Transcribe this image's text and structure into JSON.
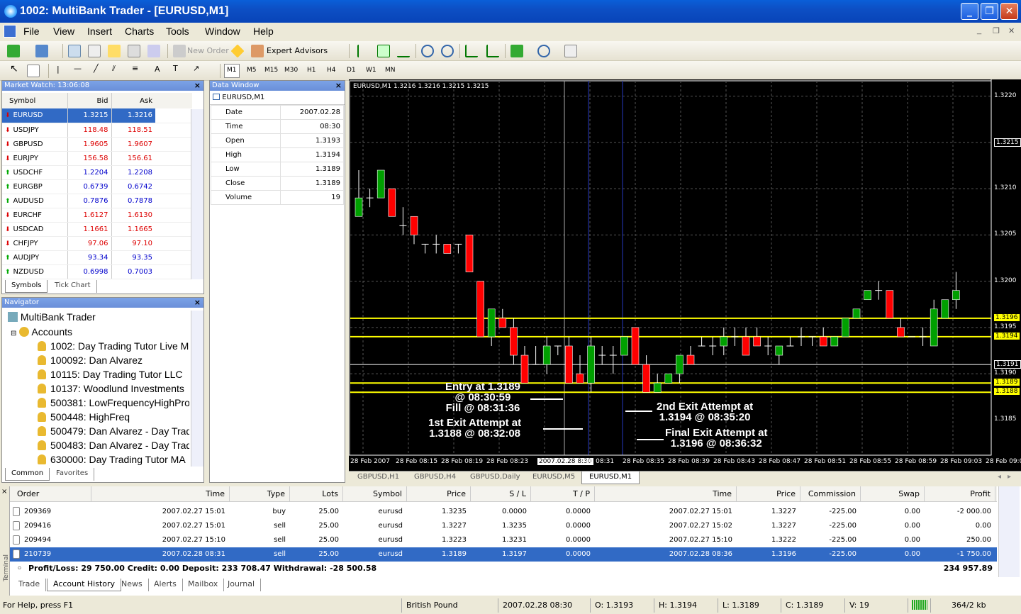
{
  "window": {
    "title": "1002: MultiBank Trader - [EURUSD,M1]"
  },
  "menu": [
    "File",
    "View",
    "Insert",
    "Charts",
    "Tools",
    "Window",
    "Help"
  ],
  "toolbar": {
    "new_order": "New Order",
    "expert_advisors": "Expert Advisors",
    "timeframes": [
      "M1",
      "M5",
      "M15",
      "M30",
      "H1",
      "H4",
      "D1",
      "W1",
      "MN"
    ]
  },
  "market_watch": {
    "title": "Market Watch: 13:06:08",
    "cols": [
      "Symbol",
      "Bid",
      "Ask"
    ],
    "rows": [
      {
        "sym": "EURUSD",
        "bid": "1.3215",
        "ask": "1.3216",
        "dir": "down",
        "sel": true
      },
      {
        "sym": "USDJPY",
        "bid": "118.48",
        "ask": "118.51",
        "dir": "down"
      },
      {
        "sym": "GBPUSD",
        "bid": "1.9605",
        "ask": "1.9607",
        "dir": "down"
      },
      {
        "sym": "EURJPY",
        "bid": "156.58",
        "ask": "156.61",
        "dir": "down"
      },
      {
        "sym": "USDCHF",
        "bid": "1.2204",
        "ask": "1.2208",
        "dir": "up"
      },
      {
        "sym": "EURGBP",
        "bid": "0.6739",
        "ask": "0.6742",
        "dir": "up"
      },
      {
        "sym": "AUDUSD",
        "bid": "0.7876",
        "ask": "0.7878",
        "dir": "up"
      },
      {
        "sym": "EURCHF",
        "bid": "1.6127",
        "ask": "1.6130",
        "dir": "down"
      },
      {
        "sym": "USDCAD",
        "bid": "1.1661",
        "ask": "1.1665",
        "dir": "down"
      },
      {
        "sym": "CHFJPY",
        "bid": "97.06",
        "ask": "97.10",
        "dir": "down"
      },
      {
        "sym": "AUDJPY",
        "bid": "93.34",
        "ask": "93.35",
        "dir": "up"
      },
      {
        "sym": "NZDUSD",
        "bid": "0.6998",
        "ask": "0.7003",
        "dir": "up"
      }
    ],
    "tabs": [
      "Symbols",
      "Tick Chart"
    ]
  },
  "data_window": {
    "title": "Data Window",
    "symbol": "EURUSD,M1",
    "rows": [
      {
        "k": "Date",
        "v": "2007.02.28"
      },
      {
        "k": "Time",
        "v": "08:30"
      },
      {
        "k": "Open",
        "v": "1.3193"
      },
      {
        "k": "High",
        "v": "1.3194"
      },
      {
        "k": "Low",
        "v": "1.3189"
      },
      {
        "k": "Close",
        "v": "1.3189"
      },
      {
        "k": "Volume",
        "v": "19"
      }
    ]
  },
  "navigator": {
    "title": "Navigator",
    "root": "MultiBank Trader",
    "accounts": "Accounts",
    "items": [
      "1002: Day Trading Tutor Live M",
      "100092: Dan Alvarez",
      "10115: Day Trading Tutor LLC",
      "10137: Woodlund Investments",
      "500381: LowFrequencyHighPro",
      "500448: HighFreq",
      "500479: Dan Alvarez - Day Trad",
      "500483: Dan Alvarez - Day Trad",
      "630000: Day Trading Tutor MA"
    ],
    "tabs": [
      "Common",
      "Favorites"
    ]
  },
  "chart": {
    "header": "EURUSD,M1  1.3216 1.3216 1.3215 1.3215",
    "price_labels": [
      "1.3220",
      "1.3215",
      "1.3210",
      "1.3205",
      "1.3200",
      "1.3196",
      "1.3195",
      "1.3194",
      "1.3191",
      "1.3190",
      "1.3189",
      "1.3188",
      "1.3185"
    ],
    "time_labels": [
      "28 Feb 2007",
      "28 Feb 08:15",
      "28 Feb 08:19",
      "28 Feb 08:23",
      "2007.02.28 8:30",
      "eb 08:31",
      "28 Feb 08:35",
      "28 Feb 08:39",
      "28 Feb 08:43",
      "28 Feb 08:47",
      "28 Feb 08:51",
      "28 Feb 08:55",
      "28 Feb 08:59",
      "28 Feb 09:03",
      "28 Feb 09:07"
    ],
    "annotations": [
      {
        "l1": "Entry at 1.3189",
        "l2": "@ 08:30:59",
        "l3": "Fill @ 08:31:36"
      },
      {
        "l1": "1st Exit Attempt at",
        "l2": "1.3188 @ 08:32:08"
      },
      {
        "l1": "2nd Exit Attempt at",
        "l2": "1.3194 @ 08:35:20"
      },
      {
        "l1": "Final Exit Attempt at",
        "l2": "1.3196 @ 08:36:32"
      }
    ],
    "tabs": [
      "GBPUSD,H1",
      "GBPUSD,H4",
      "GBPUSD,Daily",
      "EURUSD,M5",
      "EURUSD,M1"
    ]
  },
  "terminal": {
    "cols": [
      "Order",
      "Time",
      "Type",
      "Lots",
      "Symbol",
      "Price",
      "S / L",
      "T / P",
      "Time",
      "Price",
      "Commission",
      "Swap",
      "Profit"
    ],
    "rows": [
      [
        "209369",
        "2007.02.27 15:01",
        "buy",
        "25.00",
        "eurusd",
        "1.3235",
        "0.0000",
        "0.0000",
        "2007.02.27 15:01",
        "1.3227",
        "-225.00",
        "0.00",
        "-2 000.00"
      ],
      [
        "209416",
        "2007.02.27 15:01",
        "sell",
        "25.00",
        "eurusd",
        "1.3227",
        "1.3235",
        "0.0000",
        "2007.02.27 15:02",
        "1.3227",
        "-225.00",
        "0.00",
        "0.00"
      ],
      [
        "209494",
        "2007.02.27 15:10",
        "sell",
        "25.00",
        "eurusd",
        "1.3223",
        "1.3231",
        "0.0000",
        "2007.02.27 15:10",
        "1.3222",
        "-225.00",
        "0.00",
        "250.00"
      ],
      [
        "210739",
        "2007.02.28 08:31",
        "sell",
        "25.00",
        "eurusd",
        "1.3189",
        "1.3197",
        "0.0000",
        "2007.02.28 08:36",
        "1.3196",
        "-225.00",
        "0.00",
        "-1 750.00"
      ]
    ],
    "summary": "Profit/Loss: 29 750.00  Credit: 0.00  Deposit: 233 708.47  Withdrawal: -28 500.58",
    "total": "234 957.89",
    "tabs": [
      "Trade",
      "Account History",
      "News",
      "Alerts",
      "Mailbox",
      "Journal"
    ],
    "side_label": "Terminal"
  },
  "status": {
    "help": "For Help, press F1",
    "profile": "British Pound",
    "time": "2007.02.28 08:30",
    "open": "O: 1.3193",
    "high": "H: 1.3194",
    "low": "L: 1.3189",
    "close": "C: 1.3189",
    "volume": "V: 19",
    "traffic": "364/2 kb"
  },
  "colors": {
    "bull": "#00a000",
    "bear": "#ff0000",
    "level": "#ffff00",
    "vline": "#2030a0",
    "select": "#316ac5"
  },
  "candles": [
    {
      "o": 1.3207,
      "h": 1.3212,
      "l": 1.3208,
      "c": 1.3209
    },
    {
      "o": 1.3209,
      "h": 1.321,
      "l": 1.3208,
      "c": 1.3209
    },
    {
      "o": 1.3209,
      "h": 1.3212,
      "l": 1.3209,
      "c": 1.3212
    },
    {
      "o": 1.321,
      "h": 1.321,
      "l": 1.3207,
      "c": 1.3207
    },
    {
      "o": 1.3206,
      "h": 1.3208,
      "l": 1.3205,
      "c": 1.3206
    },
    {
      "o": 1.3207,
      "h": 1.3207,
      "l": 1.3204,
      "c": 1.3205
    },
    {
      "o": 1.3204,
      "h": 1.3204,
      "l": 1.3203,
      "c": 1.3204
    },
    {
      "o": 1.3204,
      "h": 1.3205,
      "l": 1.3203,
      "c": 1.3204
    },
    {
      "o": 1.3204,
      "h": 1.3204,
      "l": 1.3203,
      "c": 1.3203
    },
    {
      "o": 1.3204,
      "h": 1.3204,
      "l": 1.3203,
      "c": 1.3204
    },
    {
      "o": 1.3205,
      "h": 1.3205,
      "l": 1.3201,
      "c": 1.3201
    },
    {
      "o": 1.32,
      "h": 1.32,
      "l": 1.3194,
      "c": 1.3194
    },
    {
      "o": 1.3194,
      "h": 1.3197,
      "l": 1.3193,
      "c": 1.3197
    },
    {
      "o": 1.3196,
      "h": 1.3197,
      "l": 1.3195,
      "c": 1.3195
    },
    {
      "o": 1.3195,
      "h": 1.3196,
      "l": 1.3191,
      "c": 1.3192
    },
    {
      "o": 1.3192,
      "h": 1.3193,
      "l": 1.3189,
      "c": 1.3189
    },
    {
      "o": 1.3191,
      "h": 1.3193,
      "l": 1.3191,
      "c": 1.3191
    },
    {
      "o": 1.3191,
      "h": 1.3194,
      "l": 1.319,
      "c": 1.3193
    },
    {
      "o": 1.3193,
      "h": 1.3193,
      "l": 1.3192,
      "c": 1.3193
    },
    {
      "o": 1.3193,
      "h": 1.3194,
      "l": 1.3189,
      "c": 1.3189
    },
    {
      "o": 1.319,
      "h": 1.3192,
      "l": 1.3189,
      "c": 1.3189
    },
    {
      "o": 1.3189,
      "h": 1.3194,
      "l": 1.3188,
      "c": 1.3193
    },
    {
      "o": 1.3192,
      "h": 1.3193,
      "l": 1.3191,
      "c": 1.3192
    },
    {
      "o": 1.3192,
      "h": 1.3193,
      "l": 1.319,
      "c": 1.3192
    },
    {
      "o": 1.3192,
      "h": 1.3194,
      "l": 1.3192,
      "c": 1.3194
    },
    {
      "o": 1.3195,
      "h": 1.3195,
      "l": 1.3191,
      "c": 1.3191
    },
    {
      "o": 1.3191,
      "h": 1.3192,
      "l": 1.3188,
      "c": 1.3188
    },
    {
      "o": 1.3188,
      "h": 1.319,
      "l": 1.3188,
      "c": 1.3189
    },
    {
      "o": 1.3189,
      "h": 1.319,
      "l": 1.3189,
      "c": 1.319
    },
    {
      "o": 1.319,
      "h": 1.3192,
      "l": 1.3189,
      "c": 1.3192
    },
    {
      "o": 1.3192,
      "h": 1.3193,
      "l": 1.3191,
      "c": 1.3191
    },
    {
      "o": 1.3193,
      "h": 1.3194,
      "l": 1.3193,
      "c": 1.3193
    },
    {
      "o": 1.3193,
      "h": 1.3194,
      "l": 1.3192,
      "c": 1.3193
    },
    {
      "o": 1.3193,
      "h": 1.3195,
      "l": 1.3192,
      "c": 1.3194
    },
    {
      "o": 1.3194,
      "h": 1.3195,
      "l": 1.3193,
      "c": 1.3194
    },
    {
      "o": 1.3194,
      "h": 1.3195,
      "l": 1.3192,
      "c": 1.3192
    },
    {
      "o": 1.3194,
      "h": 1.3195,
      "l": 1.3193,
      "c": 1.3193
    },
    {
      "o": 1.3193,
      "h": 1.3194,
      "l": 1.3192,
      "c": 1.3193
    },
    {
      "o": 1.3192,
      "h": 1.3193,
      "l": 1.3191,
      "c": 1.3193
    },
    {
      "o": 1.3193,
      "h": 1.3194,
      "l": 1.3193,
      "c": 1.3193
    },
    {
      "o": 1.3194,
      "h": 1.3195,
      "l": 1.3193,
      "c": 1.3194
    },
    {
      "o": 1.3194,
      "h": 1.3194,
      "l": 1.3193,
      "c": 1.3194
    },
    {
      "o": 1.3194,
      "h": 1.3195,
      "l": 1.3193,
      "c": 1.3193
    },
    {
      "o": 1.3193,
      "h": 1.3194,
      "l": 1.3193,
      "c": 1.3194
    },
    {
      "o": 1.3194,
      "h": 1.3196,
      "l": 1.3194,
      "c": 1.3196
    },
    {
      "o": 1.3196,
      "h": 1.3197,
      "l": 1.3196,
      "c": 1.3197
    },
    {
      "o": 1.3198,
      "h": 1.3199,
      "l": 1.3198,
      "c": 1.3199
    },
    {
      "o": 1.3199,
      "h": 1.32,
      "l": 1.3198,
      "c": 1.3199
    },
    {
      "o": 1.3199,
      "h": 1.3199,
      "l": 1.3196,
      "c": 1.3196
    },
    {
      "o": 1.3195,
      "h": 1.3196,
      "l": 1.3194,
      "c": 1.3194
    },
    {
      "o": 1.3194,
      "h": 1.3194,
      "l": 1.3194,
      "c": 1.3194
    },
    {
      "o": 1.3194,
      "h": 1.3195,
      "l": 1.3193,
      "c": 1.3194
    },
    {
      "o": 1.3193,
      "h": 1.3198,
      "l": 1.3193,
      "c": 1.3197
    },
    {
      "o": 1.3196,
      "h": 1.3198,
      "l": 1.3196,
      "c": 1.3198
    },
    {
      "o": 1.3198,
      "h": 1.3201,
      "l": 1.3197,
      "c": 1.3199
    }
  ]
}
